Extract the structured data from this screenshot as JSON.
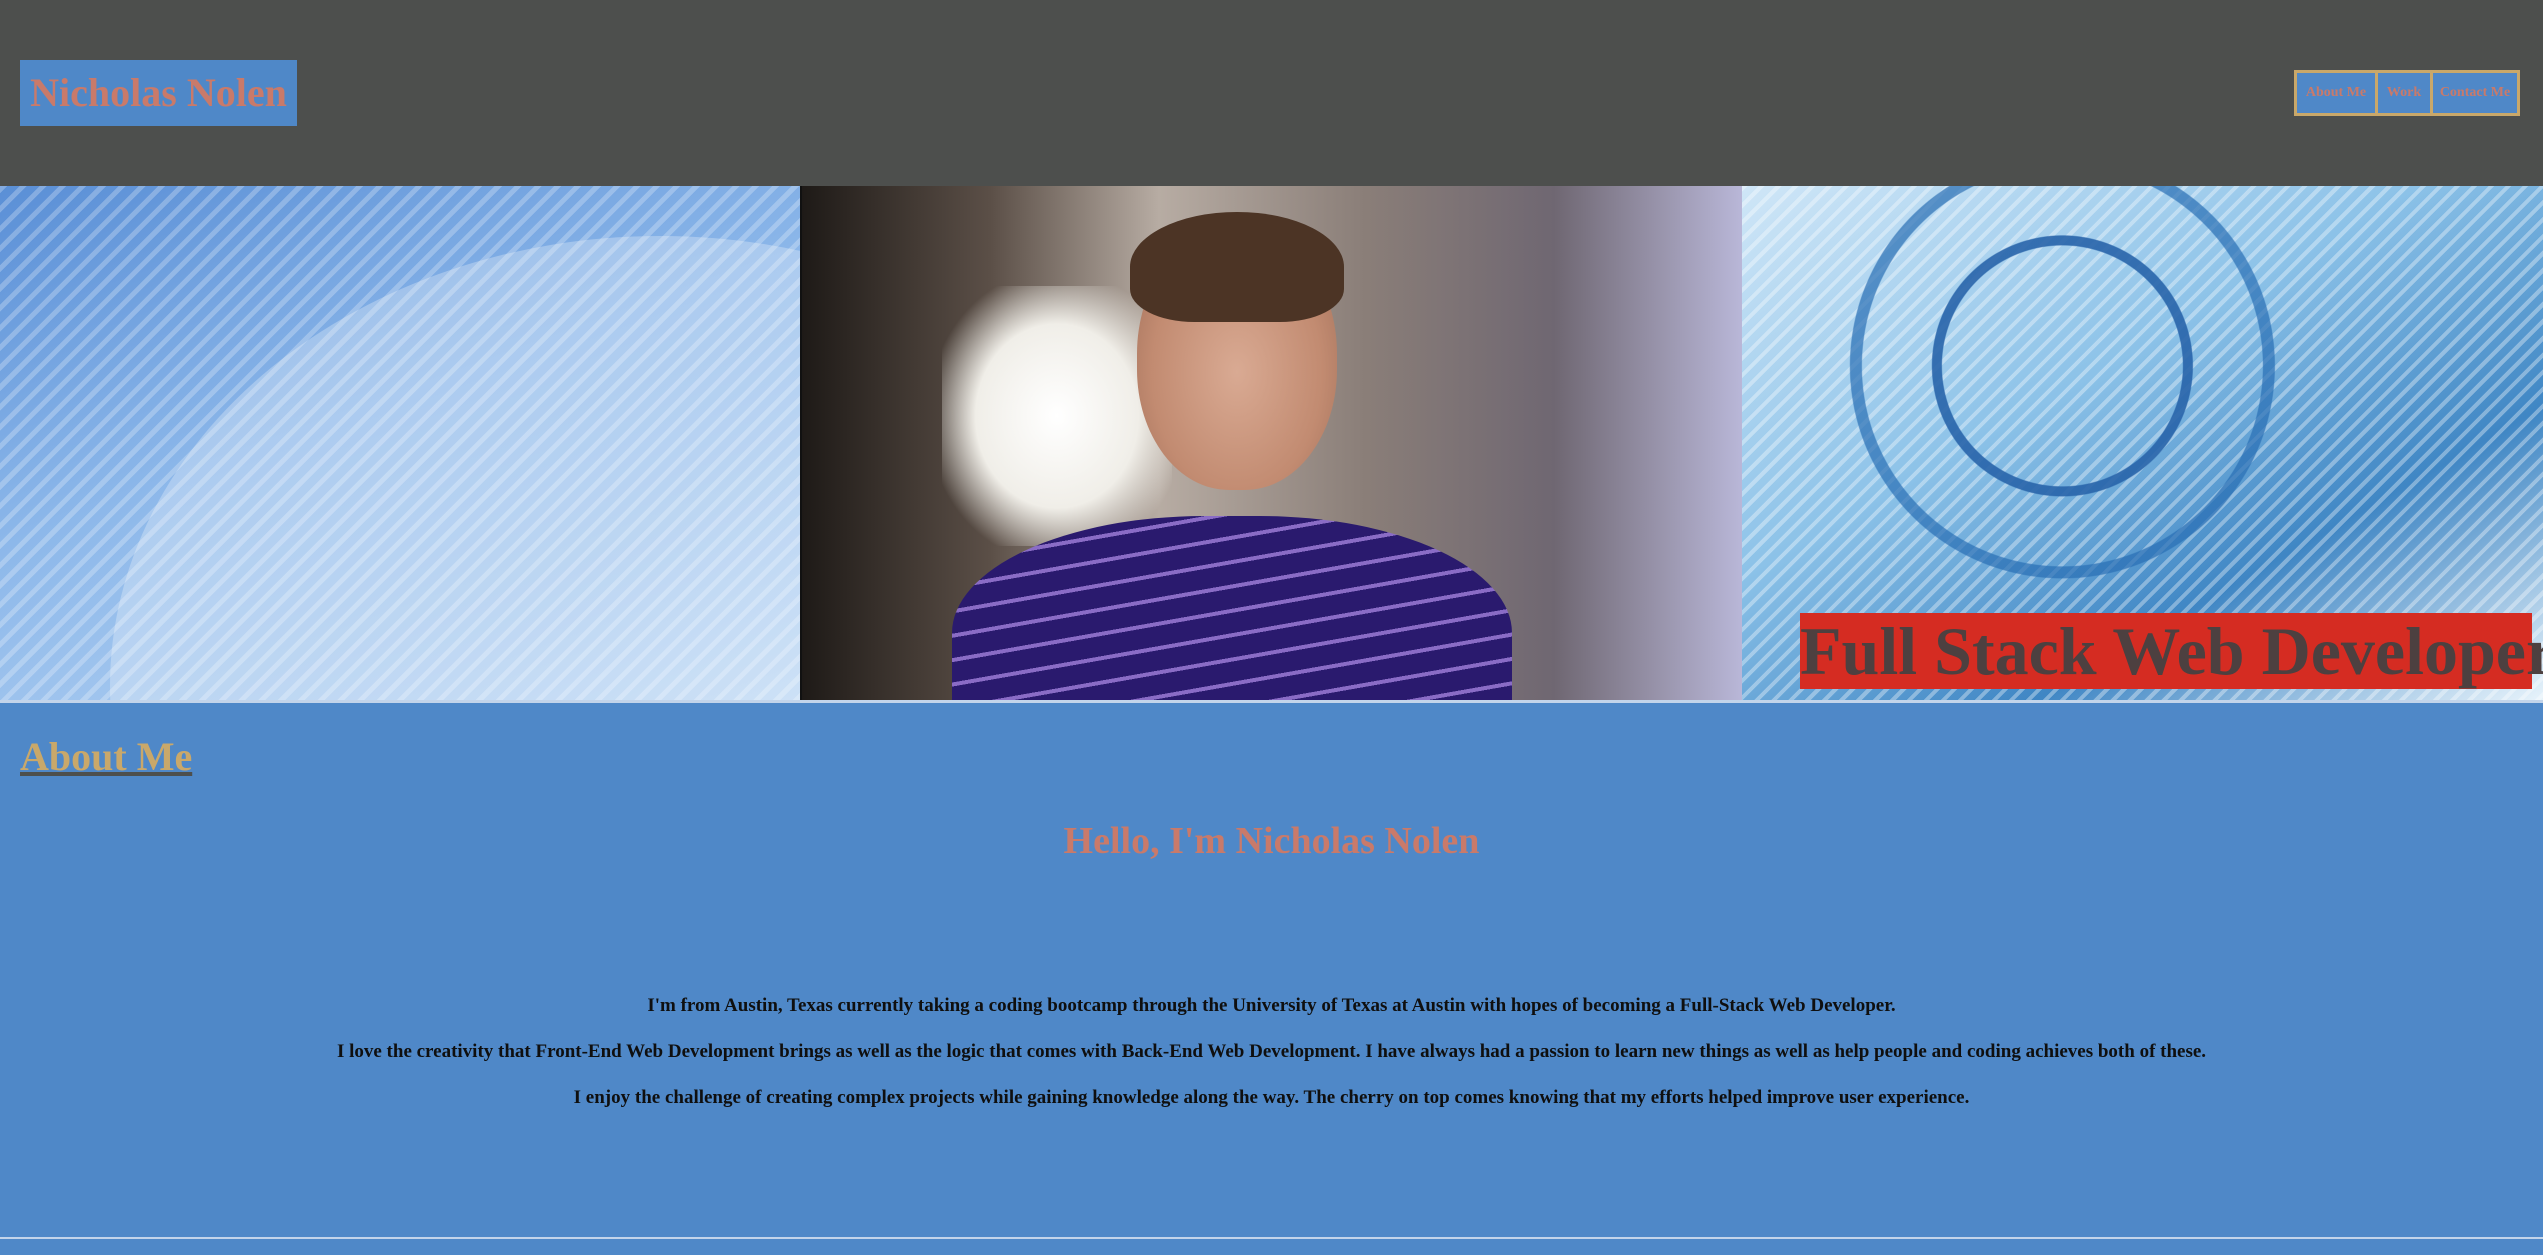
{
  "header": {
    "brand": "Nicholas Nolen",
    "nav": [
      {
        "label": "About Me"
      },
      {
        "label": "Work"
      },
      {
        "label": "Contact Me"
      }
    ]
  },
  "hero": {
    "banner": "Full Stack Web Developer"
  },
  "about": {
    "title": "About Me",
    "greeting": "Hello, I'm Nicholas Nolen",
    "paragraphs": [
      "I'm from Austin, Texas currently taking a coding bootcamp through the University of Texas at Austin with hopes of becoming a Full-Stack Web Developer.",
      "I love the creativity that Front-End Web Development brings as well as the logic that comes with Back-End Web Development. I have always had a passion to learn new things as well as help people and coding achieves both of these.",
      "I enjoy the challenge of creating complex projects while gaining knowledge along the way. The cherry on top comes knowing that my efforts helped improve user experience."
    ]
  },
  "colors": {
    "header_bg": "#4d4f4d",
    "section_bg": "#4f88c8",
    "accent_gold": "#c9a86a",
    "accent_salmon": "#c97a6a",
    "banner_red": "#d52c22"
  }
}
